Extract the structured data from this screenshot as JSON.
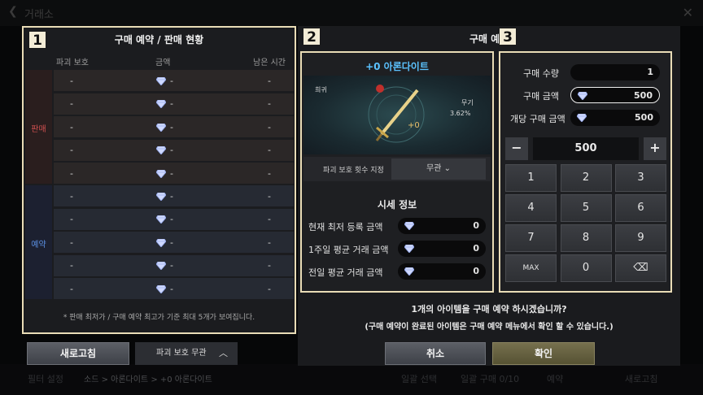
{
  "app": {
    "title": "거래소",
    "close_icon": "close-icon"
  },
  "background": {
    "filter_label": "필터 설정",
    "breadcrumb": "소드 > 아론다이트 > +0 아론다이트",
    "bulk_select": "일괄 선택",
    "bulk_buy": "일괄 구매 0/10",
    "reserve": "예약",
    "refresh": "새로고침"
  },
  "panel1": {
    "badge": "1",
    "title": "구매 예약 / 판매 현황",
    "columns": [
      "파괴 보호",
      "금액",
      "남은 시간"
    ],
    "sell_label": "판매",
    "buy_label": "예약",
    "sell_rows": [
      {
        "protect": "-",
        "price": "-",
        "time": "-"
      },
      {
        "protect": "-",
        "price": "-",
        "time": "-"
      },
      {
        "protect": "-",
        "price": "-",
        "time": "-"
      },
      {
        "protect": "-",
        "price": "-",
        "time": "-"
      },
      {
        "protect": "-",
        "price": "-",
        "time": "-"
      }
    ],
    "buy_rows": [
      {
        "protect": "-",
        "price": "-",
        "time": "-"
      },
      {
        "protect": "-",
        "price": "-",
        "time": "-"
      },
      {
        "protect": "-",
        "price": "-",
        "time": "-"
      },
      {
        "protect": "-",
        "price": "-",
        "time": "-"
      },
      {
        "protect": "-",
        "price": "-",
        "time": "-"
      }
    ],
    "footnote": "* 판매 최저가 / 구매 예약 최고가 기준 최대 5개가 보여집니다.",
    "refresh_button": "새로고침",
    "protect_dropdown": "파괴 보호 무관"
  },
  "panel2": {
    "badge": "2",
    "header": "구매 예",
    "item_name": "+0 아론다이트",
    "rarity": "희귀",
    "weapon_type": "무기",
    "rate": "3.62%",
    "enhance": "+0",
    "protect_label": "파괴 보호 횟수 지정",
    "protect_value": "무관",
    "market_title": "시세 정보",
    "market_rows": [
      {
        "label": "현재 최저 등록 금액",
        "value": "0"
      },
      {
        "label": "1주일 평균 거래 금액",
        "value": "0"
      },
      {
        "label": "전일 평균 거래 금액",
        "value": "0"
      }
    ]
  },
  "panel3": {
    "badge": "3",
    "qty_label": "구매 수량",
    "qty_value": "1",
    "price_label": "구매 금액",
    "price_value": "500",
    "unit_label": "개당 구매 금액",
    "unit_value": "500",
    "stepper_value": "500",
    "minus": "−",
    "plus": "+",
    "keys": [
      "1",
      "2",
      "3",
      "4",
      "5",
      "6",
      "7",
      "8",
      "9",
      "MAX",
      "0",
      "⌫"
    ]
  },
  "confirm": {
    "line1": "1개의 아이템을 구매 예약 하시겠습니까?",
    "line2": "(구매 예약이 완료된 아이템은 구매 예약 메뉴에서 확인 할 수 있습니다.)",
    "cancel": "취소",
    "ok": "확인"
  },
  "colors": {
    "highlight_border": "#e9dcb6",
    "item_name": "#5bc2ff",
    "sell_label": "#d05050",
    "buy_label": "#5a8ee0",
    "ok_button": "#6a6444"
  }
}
